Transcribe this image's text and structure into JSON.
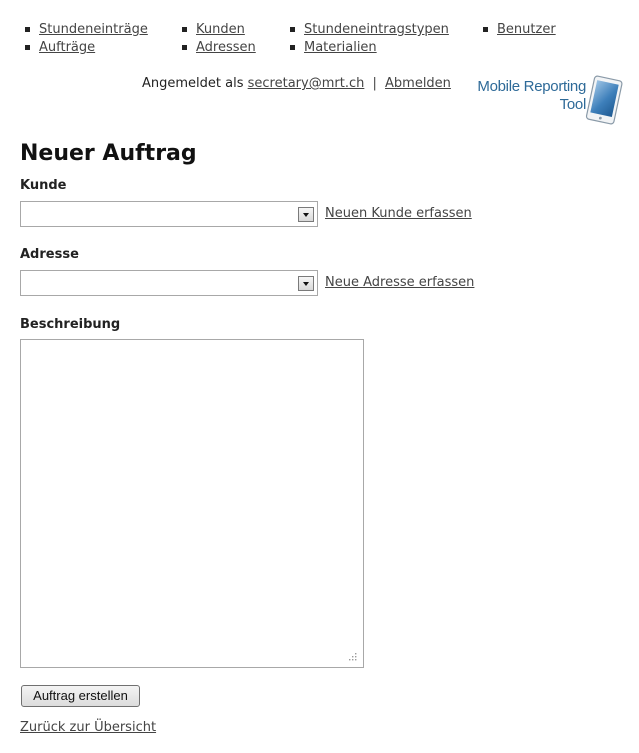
{
  "nav": {
    "items": [
      {
        "label": "Stundeneinträge"
      },
      {
        "label": "Aufträge"
      },
      {
        "label": "Kunden"
      },
      {
        "label": "Adressen"
      },
      {
        "label": "Stundeneintragstypen"
      },
      {
        "label": "Materialien"
      },
      {
        "label": "Benutzer"
      }
    ]
  },
  "header": {
    "logged_in_as": "Angemeldet als",
    "user_email": "secretary@mrt.ch",
    "separator": "|",
    "logout_label": "Abmelden",
    "logo_text_line1": "Mobile Reporting",
    "logo_text_line2": "Tool"
  },
  "form": {
    "title": "Neuer Auftrag",
    "customer": {
      "label": "Kunde",
      "selected_value": "",
      "new_link": "Neuen Kunde erfassen"
    },
    "address": {
      "label": "Adresse",
      "selected_value": "",
      "new_link": "Neue Adresse erfassen"
    },
    "description": {
      "label": "Beschreibung",
      "value": ""
    },
    "submit_label": "Auftrag erstellen",
    "back_link": "Zurück zur Übersicht"
  },
  "colors": {
    "link": "#444444",
    "logo_blue": "#2e6a98",
    "border": "#a8a8a8"
  },
  "icons": {
    "nav_bullet": "square-bullet-icon",
    "dropdown": "chevron-down-icon",
    "logo": "tablet-icon",
    "resize": "resize-grip-icon"
  }
}
